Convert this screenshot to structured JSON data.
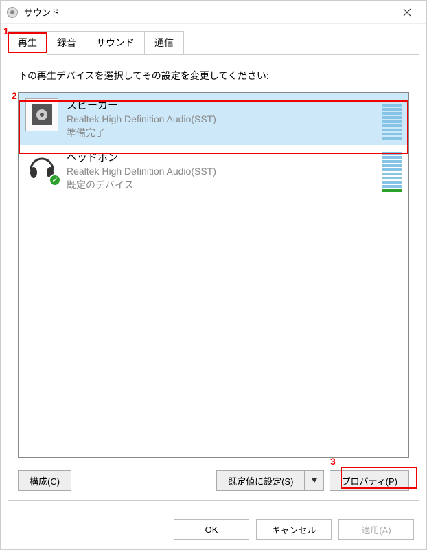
{
  "title": "サウンド",
  "tabs": [
    "再生",
    "録音",
    "サウンド",
    "通信"
  ],
  "active_tab_index": 0,
  "instruction": "下の再生デバイスを選択してその設定を変更してください:",
  "devices": [
    {
      "name": "スピーカー",
      "description": "Realtek High Definition Audio(SST)",
      "status": "準備完了",
      "selected": true,
      "default": false,
      "meter_color": "blue"
    },
    {
      "name": "ヘッドホン",
      "description": "Realtek High Definition Audio(SST)",
      "status": "既定のデバイス",
      "selected": false,
      "default": true,
      "meter_color": "mixed"
    }
  ],
  "buttons": {
    "configure": "構成(C)",
    "set_default": "既定値に設定(S)",
    "properties": "プロパティ(P)",
    "ok": "OK",
    "cancel": "キャンセル",
    "apply": "適用(A)"
  },
  "annotations": {
    "a1": "1",
    "a2": "2",
    "a3": "3"
  }
}
